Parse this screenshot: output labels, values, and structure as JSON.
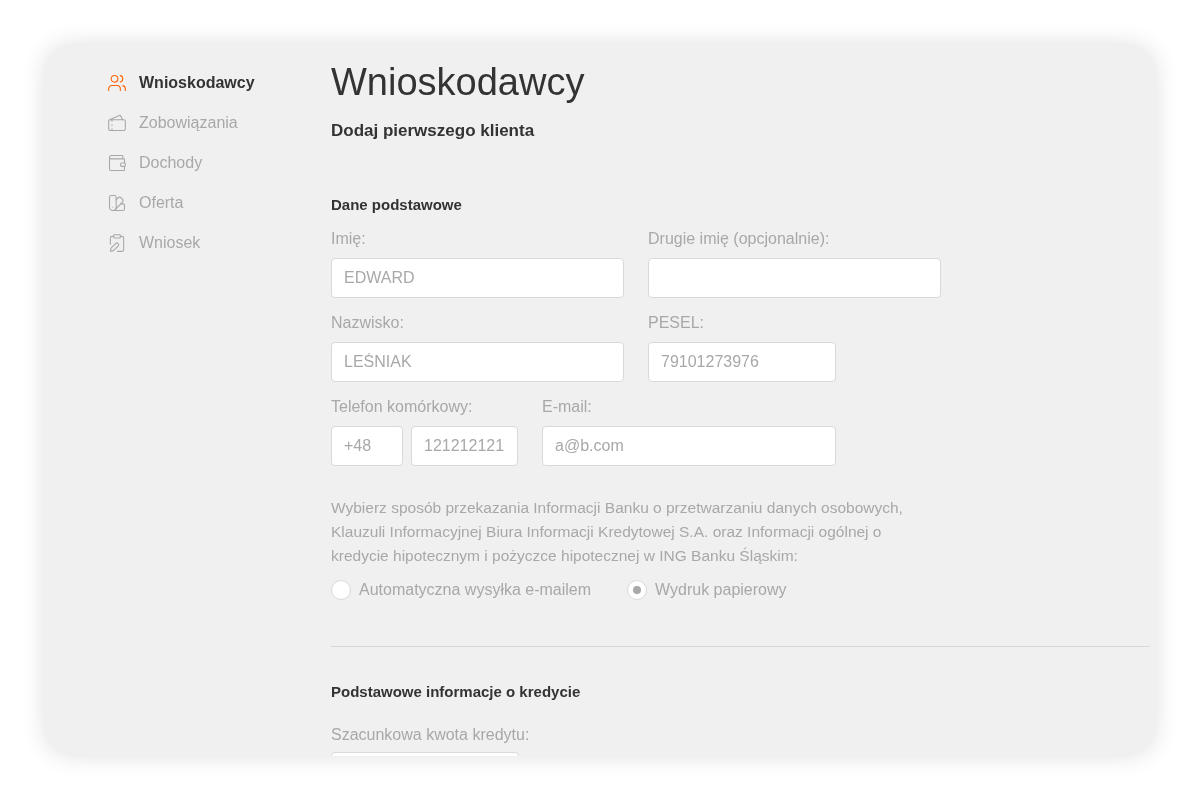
{
  "sidebar": {
    "items": [
      {
        "kind": "people",
        "label": "Wnioskodawcy",
        "selected": true
      },
      {
        "kind": "cards",
        "label": "Zobowiązania",
        "selected": false
      },
      {
        "kind": "wallet",
        "label": "Dochody",
        "selected": false
      },
      {
        "kind": "swatch",
        "label": "Oferta",
        "selected": false
      },
      {
        "kind": "clipboard",
        "label": "Wniosek",
        "selected": false
      }
    ]
  },
  "title": "Wnioskodawcy",
  "subtitle": "Dodaj pierwszego klienta",
  "basic_section": {
    "heading": "Dane podstawowe",
    "rows": [
      [
        {
          "label": "Imię:",
          "values": [
            "EDWARD"
          ]
        },
        {
          "label": "Drugie imię (opcjonalnie):"
        }
      ],
      [
        {
          "label": "Nazwisko:",
          "values": [
            "LEŚNIAK"
          ]
        },
        {
          "label": "PESEL:",
          "values": [
            "79101273976"
          ]
        }
      ],
      [
        {
          "label": "Telefon komórkowy:",
          "values": [
            "+48",
            "121212121"
          ]
        },
        {
          "label": "E-mail:",
          "values": [
            "a@b.com"
          ]
        }
      ]
    ],
    "consent_text": "Wybierz sposób przekazania Informacji Banku o przetwarzaniu danych osobowych, Klauzuli Informacyjnej Biura Informacji Kredytowej S.A. oraz Informacji ogólnej o kredycie hipotecznym i pożyczce hipotecznej w ING Banku Śląskim:",
    "delivery_options": [
      {
        "label": "Automatyczna wysyłka e-mailem",
        "selected": false
      },
      {
        "label": "Wydruk papierowy",
        "selected": true
      }
    ]
  },
  "credit_section": {
    "heading": "Podstawowe informacje o kredycie",
    "fields": [
      {
        "label": "Szacunkowa kwota kredytu:"
      }
    ]
  }
}
